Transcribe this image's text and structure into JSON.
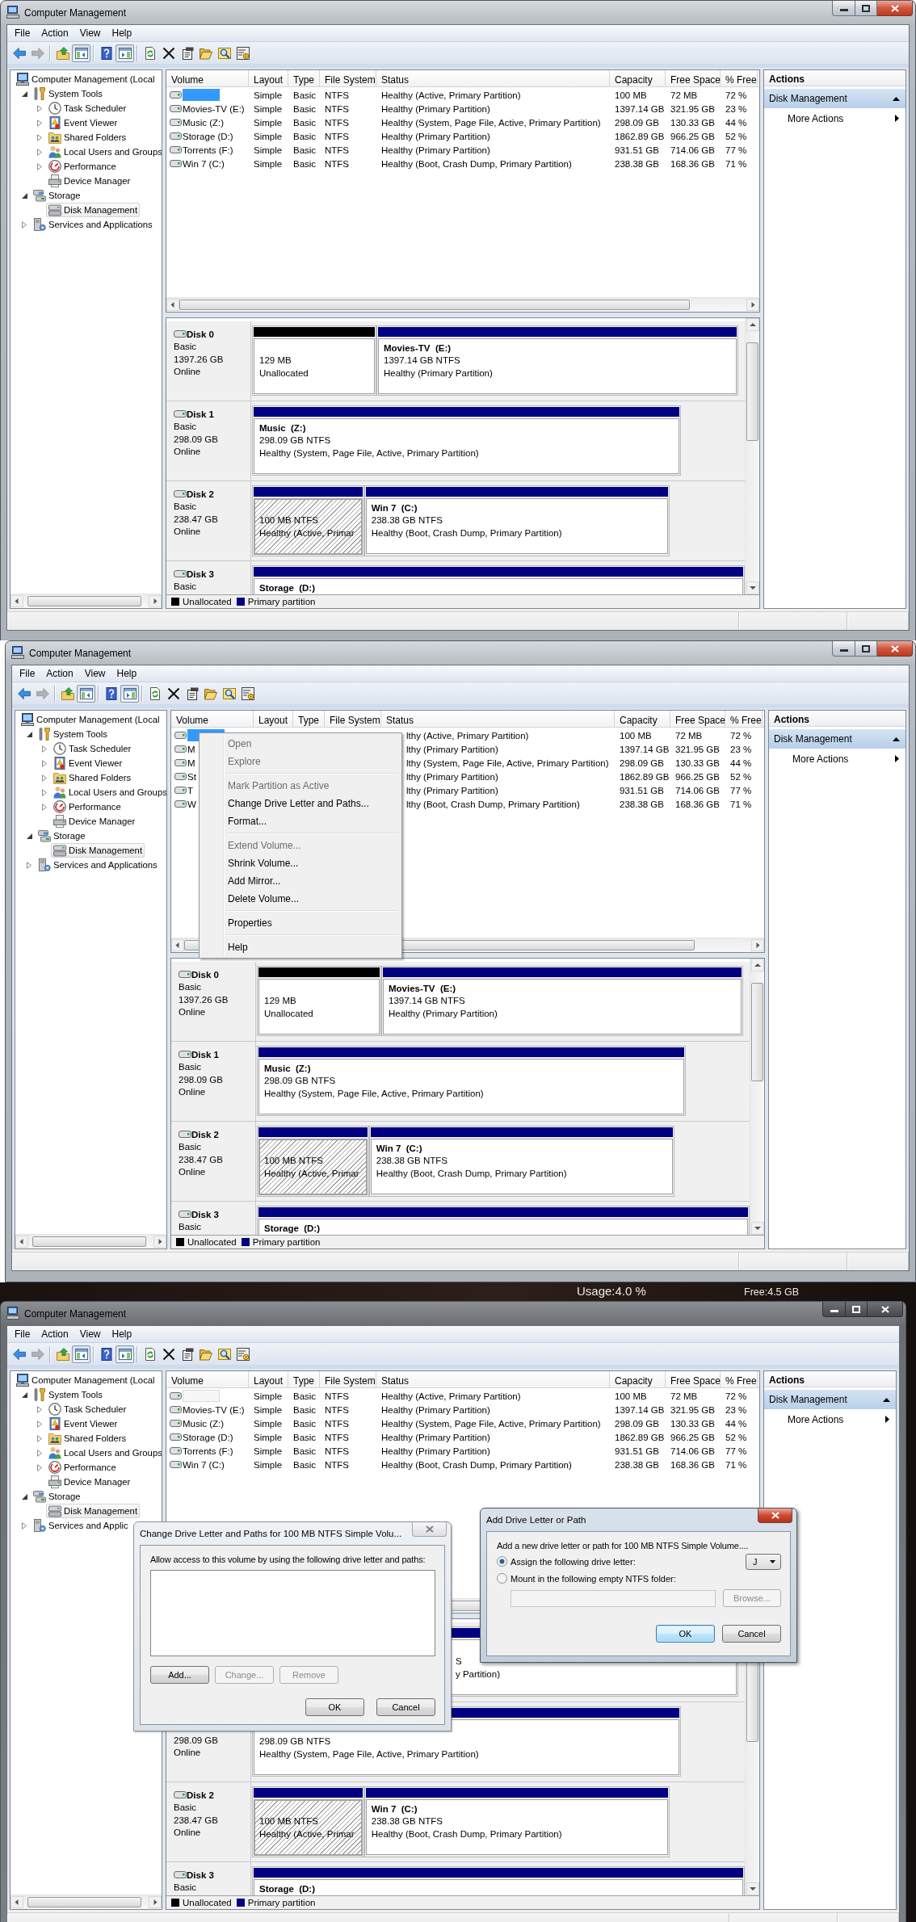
{
  "screenshots": [
    {
      "window": {
        "title": "Computer Management",
        "focused": true,
        "menu": [
          "File",
          "Action",
          "View",
          "Help"
        ],
        "toolbar": [
          [
            {
              "kind": "back",
              "disabled": false,
              "pressed": false
            },
            {
              "kind": "forward",
              "disabled": true,
              "pressed": false
            }
          ],
          [
            {
              "kind": "up",
              "disabled": false,
              "pressed": false
            },
            {
              "kind": "tree",
              "disabled": false,
              "pressed": true
            }
          ],
          [
            {
              "kind": "help",
              "disabled": false,
              "pressed": false
            },
            {
              "kind": "pane",
              "disabled": false,
              "pressed": true
            }
          ],
          [
            {
              "kind": "refresh",
              "disabled": false,
              "pressed": false
            },
            {
              "kind": "delete",
              "disabled": false,
              "pressed": false
            },
            {
              "kind": "properties",
              "disabled": false,
              "pressed": false
            },
            {
              "kind": "open",
              "disabled": false,
              "pressed": false
            },
            {
              "kind": "search",
              "disabled": false,
              "pressed": false
            },
            {
              "kind": "settings",
              "disabled": false,
              "pressed": false
            }
          ]
        ],
        "tree": [
          {
            "kind": "computer",
            "label": "Computer Management (Local",
            "selected": false,
            "children": [
              {
                "kind": "tools",
                "label": "System Tools",
                "expanded": true,
                "selected": false,
                "children": [
                  {
                    "kind": "scheduler",
                    "label": "Task Scheduler",
                    "expanded": false,
                    "selected": false
                  },
                  {
                    "kind": "events",
                    "label": "Event Viewer",
                    "expanded": false,
                    "selected": false
                  },
                  {
                    "kind": "shares",
                    "label": "Shared Folders",
                    "expanded": false,
                    "selected": false
                  },
                  {
                    "kind": "users",
                    "label": "Local Users and Groups",
                    "expanded": false,
                    "selected": false
                  },
                  {
                    "kind": "performance",
                    "label": "Performance",
                    "expanded": false,
                    "selected": false
                  },
                  {
                    "kind": "devices",
                    "label": "Device Manager",
                    "selected": false
                  }
                ]
              },
              {
                "kind": "storage",
                "label": "Storage",
                "expanded": true,
                "selected": false,
                "children": [
                  {
                    "kind": "disks",
                    "label": "Disk Management",
                    "selected": true
                  }
                ]
              },
              {
                "kind": "services",
                "label": "Services and Applications",
                "expanded": false,
                "selected": false
              }
            ]
          }
        ],
        "volumes": {
          "columns": [
            "Volume",
            "Layout",
            "Type",
            "File System",
            "Status",
            "Capacity",
            "Free Space",
            "% Free"
          ],
          "rows": [
            {
              "selected": true,
              "layout": "Simple",
              "type": "Basic",
              "file_system": "NTFS",
              "status": "Healthy (Active, Primary Partition)",
              "capacity": "100 MB",
              "free_space": "72 MB",
              "percent_free": "72 %"
            },
            {
              "selected": false,
              "volume": "Movies-TV (E:)",
              "layout": "Simple",
              "type": "Basic",
              "file_system": "NTFS",
              "status": "Healthy (Primary Partition)",
              "capacity": "1397.14 GB",
              "free_space": "321.95 GB",
              "percent_free": "23 %"
            },
            {
              "selected": false,
              "volume": "Music (Z:)",
              "layout": "Simple",
              "type": "Basic",
              "file_system": "NTFS",
              "status": "Healthy (System, Page File, Active, Primary Partition)",
              "capacity": "298.09 GB",
              "free_space": "130.33 GB",
              "percent_free": "44 %"
            },
            {
              "selected": false,
              "volume": "Storage (D:)",
              "layout": "Simple",
              "type": "Basic",
              "file_system": "NTFS",
              "status": "Healthy (Primary Partition)",
              "capacity": "1862.89 GB",
              "free_space": "966.25 GB",
              "percent_free": "52 %"
            },
            {
              "selected": false,
              "volume": "Torrents (F:)",
              "layout": "Simple",
              "type": "Basic",
              "file_system": "NTFS",
              "status": "Healthy (Primary Partition)",
              "capacity": "931.51 GB",
              "free_space": "714.06 GB",
              "percent_free": "77 %"
            },
            {
              "selected": false,
              "volume": "Win 7 (C:)",
              "layout": "Simple",
              "type": "Basic",
              "file_system": "NTFS",
              "status": "Healthy (Boot, Crash Dump, Primary Partition)",
              "capacity": "238.38 GB",
              "free_space": "168.36 GB",
              "percent_free": "71 %"
            }
          ]
        },
        "disks": [
          {
            "name": "Disk 0",
            "type": "Basic",
            "size": "1397.26 GB",
            "status": "Online",
            "partitions": [
              {
                "kind": "unallocated",
                "selected": false,
                "size": "129 MB",
                "status": "Unallocated"
              },
              {
                "kind": "primary",
                "selected": false,
                "name": "Movies-TV  (E:)",
                "size": "1397.14 GB NTFS",
                "status": "Healthy (Primary Partition)"
              }
            ]
          },
          {
            "name": "Disk 1",
            "type": "Basic",
            "size": "298.09 GB",
            "status": "Online",
            "partitions": [
              {
                "kind": "primary",
                "selected": false,
                "name": "Music  (Z:)",
                "size": "298.09 GB NTFS",
                "status": "Healthy (System, Page File, Active, Primary Partition)"
              }
            ]
          },
          {
            "name": "Disk 2",
            "type": "Basic",
            "size": "238.47 GB",
            "status": "Online",
            "partitions": [
              {
                "kind": "primary",
                "selected": true,
                "size": "100 MB NTFS",
                "status": "Healthy (Active, Primar"
              },
              {
                "kind": "primary",
                "selected": false,
                "name": "Win 7  (C:)",
                "size": "238.38 GB NTFS",
                "status": "Healthy (Boot, Crash Dump, Primary Partition)"
              }
            ]
          },
          {
            "name": "Disk 3",
            "type": "Basic",
            "partitions": [
              {
                "kind": "primary",
                "selected": false,
                "name": "Storage  (D:)"
              }
            ]
          }
        ],
        "legend": [
          {
            "kind": "unallocated",
            "label": "Unallocated"
          },
          {
            "kind": "primary",
            "label": "Primary partition"
          }
        ],
        "actions": {
          "title": "Actions",
          "sections": [
            {
              "label": "Disk Management",
              "expanded": true,
              "items": [
                "More Actions"
              ]
            }
          ]
        }
      }
    },
    {
      "window": {
        "title": "Computer Management",
        "focused": true,
        "menu": [
          "File",
          "Action",
          "View",
          "Help"
        ],
        "toolbar": [
          [
            {
              "kind": "back",
              "disabled": false,
              "pressed": false
            },
            {
              "kind": "forward",
              "disabled": true,
              "pressed": false
            }
          ],
          [
            {
              "kind": "up",
              "disabled": false,
              "pressed": false
            },
            {
              "kind": "tree",
              "disabled": false,
              "pressed": true
            }
          ],
          [
            {
              "kind": "help",
              "disabled": false,
              "pressed": false
            },
            {
              "kind": "pane",
              "disabled": false,
              "pressed": true
            }
          ],
          [
            {
              "kind": "refresh",
              "disabled": false,
              "pressed": false
            },
            {
              "kind": "delete",
              "disabled": false,
              "pressed": false
            },
            {
              "kind": "properties",
              "disabled": false,
              "pressed": false
            },
            {
              "kind": "open",
              "disabled": false,
              "pressed": false
            },
            {
              "kind": "search",
              "disabled": false,
              "pressed": false
            },
            {
              "kind": "settings",
              "disabled": false,
              "pressed": false
            }
          ]
        ],
        "tree": [
          {
            "kind": "computer",
            "label": "Computer Management (Local",
            "selected": false,
            "children": [
              {
                "kind": "tools",
                "label": "System Tools",
                "expanded": true,
                "selected": false,
                "children": [
                  {
                    "kind": "scheduler",
                    "label": "Task Scheduler",
                    "expanded": false,
                    "selected": false
                  },
                  {
                    "kind": "events",
                    "label": "Event Viewer",
                    "expanded": false,
                    "selected": false
                  },
                  {
                    "kind": "shares",
                    "label": "Shared Folders",
                    "expanded": false,
                    "selected": false
                  },
                  {
                    "kind": "users",
                    "label": "Local Users and Groups",
                    "expanded": false,
                    "selected": false
                  },
                  {
                    "kind": "performance",
                    "label": "Performance",
                    "expanded": false,
                    "selected": false
                  },
                  {
                    "kind": "devices",
                    "label": "Device Manager",
                    "selected": false
                  }
                ]
              },
              {
                "kind": "storage",
                "label": "Storage",
                "expanded": true,
                "selected": false,
                "children": [
                  {
                    "kind": "disks",
                    "label": "Disk Management",
                    "selected": true
                  }
                ]
              },
              {
                "kind": "services",
                "label": "Services and Applications",
                "expanded": false,
                "selected": false
              }
            ]
          }
        ],
        "volumes": {
          "columns": [
            "Volume",
            "Layout",
            "Type",
            "File System",
            "Status",
            "Capacity",
            "Free Space",
            "% Free"
          ],
          "rows": [
            {
              "selected": true,
              "status": "lthy (Active, Primary Partition)",
              "capacity": "100 MB",
              "free_space": "72 MB",
              "percent_free": "72 %"
            },
            {
              "selected": false,
              "volume": "M",
              "status": "lthy (Primary Partition)",
              "capacity": "1397.14 GB",
              "free_space": "321.95 GB",
              "percent_free": "23 %"
            },
            {
              "selected": false,
              "volume": "M",
              "status": "lthy (System, Page File, Active, Primary Partition)",
              "capacity": "298.09 GB",
              "free_space": "130.33 GB",
              "percent_free": "44 %"
            },
            {
              "selected": false,
              "volume": "St",
              "status": "lthy (Primary Partition)",
              "capacity": "1862.89 GB",
              "free_space": "966.25 GB",
              "percent_free": "52 %"
            },
            {
              "selected": false,
              "volume": "T",
              "status": "lthy (Primary Partition)",
              "capacity": "931.51 GB",
              "free_space": "714.06 GB",
              "percent_free": "77 %"
            },
            {
              "selected": false,
              "volume": "W",
              "status": "lthy (Boot, Crash Dump, Primary Partition)",
              "capacity": "238.38 GB",
              "free_space": "168.36 GB",
              "percent_free": "71 %"
            }
          ]
        },
        "context_menu": {
          "groups": [
            [
              {
                "label": "Open",
                "disabled": true
              },
              {
                "label": "Explore",
                "disabled": true
              }
            ],
            [
              {
                "label": "Mark Partition as Active",
                "disabled": true
              },
              {
                "label": "Change Drive Letter and Paths...",
                "disabled": false
              },
              {
                "label": "Format...",
                "disabled": false
              }
            ],
            [
              {
                "label": "Extend Volume...",
                "disabled": true
              },
              {
                "label": "Shrink Volume...",
                "disabled": false
              },
              {
                "label": "Add Mirror...",
                "disabled": false
              },
              {
                "label": "Delete Volume...",
                "disabled": false
              }
            ],
            [
              {
                "label": "Properties",
                "disabled": false
              }
            ],
            [
              {
                "label": "Help",
                "disabled": false
              }
            ]
          ]
        },
        "disks": [
          {
            "name": "Disk 0",
            "type": "Basic",
            "size": "1397.26 GB",
            "status": "Online",
            "partitions": [
              {
                "kind": "unallocated",
                "selected": false,
                "size": "129 MB",
                "status": "Unallocated"
              },
              {
                "kind": "primary",
                "selected": false,
                "name": "Movies-TV  (E:)",
                "size": "1397.14 GB NTFS",
                "status": "Healthy (Primary Partition)"
              }
            ]
          },
          {
            "name": "Disk 1",
            "type": "Basic",
            "size": "298.09 GB",
            "status": "Online",
            "partitions": [
              {
                "kind": "primary",
                "selected": false,
                "name": "Music  (Z:)",
                "size": "298.09 GB NTFS",
                "status": "Healthy (System, Page File, Active, Primary Partition)"
              }
            ]
          },
          {
            "name": "Disk 2",
            "type": "Basic",
            "size": "238.47 GB",
            "status": "Online",
            "partitions": [
              {
                "kind": "primary",
                "selected": true,
                "size": "100 MB NTFS",
                "status": "Healthy (Active, Primar"
              },
              {
                "kind": "primary",
                "selected": false,
                "name": "Win 7  (C:)",
                "size": "238.38 GB NTFS",
                "status": "Healthy (Boot, Crash Dump, Primary Partition)"
              }
            ]
          },
          {
            "name": "Disk 3",
            "type": "Basic",
            "partitions": [
              {
                "kind": "primary",
                "selected": false,
                "name": "Storage  (D:)"
              }
            ]
          }
        ],
        "legend": [
          {
            "kind": "unallocated",
            "label": "Unallocated"
          },
          {
            "kind": "primary",
            "label": "Primary partition"
          }
        ],
        "actions": {
          "title": "Actions",
          "sections": [
            {
              "label": "Disk Management",
              "expanded": true,
              "items": [
                "More Actions"
              ]
            }
          ]
        }
      }
    },
    {
      "desktop_gadgets": [
        "Usage:4.0 %",
        "Free:4.5 GB"
      ],
      "window": {
        "title": "Computer Management",
        "focused": false,
        "menu": [
          "File",
          "Action",
          "View",
          "Help"
        ],
        "toolbar": [
          [
            {
              "kind": "back",
              "disabled": false,
              "pressed": false
            },
            {
              "kind": "forward",
              "disabled": true,
              "pressed": false
            }
          ],
          [
            {
              "kind": "up",
              "disabled": false,
              "pressed": false
            },
            {
              "kind": "tree",
              "disabled": false,
              "pressed": true
            }
          ],
          [
            {
              "kind": "help",
              "disabled": false,
              "pressed": false
            },
            {
              "kind": "pane",
              "disabled": false,
              "pressed": true
            }
          ],
          [
            {
              "kind": "refresh",
              "disabled": false,
              "pressed": false
            },
            {
              "kind": "delete",
              "disabled": false,
              "pressed": false
            },
            {
              "kind": "properties",
              "disabled": false,
              "pressed": false
            },
            {
              "kind": "open",
              "disabled": false,
              "pressed": false
            },
            {
              "kind": "search",
              "disabled": false,
              "pressed": false
            },
            {
              "kind": "settings",
              "disabled": false,
              "pressed": false
            }
          ]
        ],
        "tree": [
          {
            "kind": "computer",
            "label": "Computer Management (Local",
            "selected": false,
            "children": [
              {
                "kind": "tools",
                "label": "System Tools",
                "expanded": true,
                "selected": false,
                "children": [
                  {
                    "kind": "scheduler",
                    "label": "Task Scheduler",
                    "expanded": false,
                    "selected": false
                  },
                  {
                    "kind": "events",
                    "label": "Event Viewer",
                    "expanded": false,
                    "selected": false
                  },
                  {
                    "kind": "shares",
                    "label": "Shared Folders",
                    "expanded": false,
                    "selected": false
                  },
                  {
                    "kind": "users",
                    "label": "Local Users and Groups",
                    "expanded": false,
                    "selected": false
                  },
                  {
                    "kind": "performance",
                    "label": "Performance",
                    "expanded": false,
                    "selected": false
                  },
                  {
                    "kind": "devices",
                    "label": "Device Manager",
                    "selected": false
                  }
                ]
              },
              {
                "kind": "storage",
                "label": "Storage",
                "expanded": true,
                "selected": false,
                "children": [
                  {
                    "kind": "disks",
                    "label": "Disk Management",
                    "selected": true
                  }
                ]
              },
              {
                "kind": "services",
                "label": "Services and Applic",
                "expanded": false,
                "selected": false
              }
            ]
          }
        ],
        "volumes": {
          "columns": [
            "Volume",
            "Layout",
            "Type",
            "File System",
            "Status",
            "Capacity",
            "Free Space",
            "% Free"
          ],
          "rows": [
            {
              "selected": true,
              "layout": "Simple",
              "type": "Basic",
              "file_system": "NTFS",
              "status": "Healthy (Active, Primary Partition)",
              "capacity": "100 MB",
              "free_space": "72 MB",
              "percent_free": "72 %"
            },
            {
              "selected": false,
              "volume": "Movies-TV (E:)",
              "layout": "Simple",
              "type": "Basic",
              "file_system": "NTFS",
              "status": "Healthy (Primary Partition)",
              "capacity": "1397.14 GB",
              "free_space": "321.95 GB",
              "percent_free": "23 %"
            },
            {
              "selected": false,
              "volume": "Music (Z:)",
              "layout": "Simple",
              "type": "Basic",
              "file_system": "NTFS",
              "status": "Healthy (System, Page File, Active, Primary Partition)",
              "capacity": "298.09 GB",
              "free_space": "130.33 GB",
              "percent_free": "44 %"
            },
            {
              "selected": false,
              "volume": "Storage (D:)",
              "layout": "Simple",
              "type": "Basic",
              "file_system": "NTFS",
              "status": "Healthy (Primary Partition)",
              "capacity": "1862.89 GB",
              "free_space": "966.25 GB",
              "percent_free": "52 %"
            },
            {
              "selected": false,
              "volume": "Torrents (F:)",
              "layout": "Simple",
              "type": "Basic",
              "file_system": "NTFS",
              "status": "Healthy (Primary Partition)",
              "capacity": "931.51 GB",
              "free_space": "714.06 GB",
              "percent_free": "77 %"
            },
            {
              "selected": false,
              "volume": "Win 7 (C:)",
              "layout": "Simple",
              "type": "Basic",
              "file_system": "NTFS",
              "status": "Healthy (Boot, Crash Dump, Primary Partition)",
              "capacity": "238.38 GB",
              "free_space": "168.36 GB",
              "percent_free": "71 %"
            }
          ]
        },
        "disks": [
          {
            "partitions": [
              {
                "kind": "primary",
                "selected": false,
                "size": "S",
                "status": "y Partition)"
              }
            ]
          },
          {
            "size": "298.09 GB",
            "status": "Online",
            "partitions": [
              {
                "kind": "primary",
                "selected": false,
                "size": "298.09 GB NTFS",
                "status": "Healthy (System, Page File, Active, Primary Partition)"
              }
            ]
          },
          {
            "name": "Disk 2",
            "type": "Basic",
            "size": "238.47 GB",
            "status": "Online",
            "partitions": [
              {
                "kind": "primary",
                "selected": true,
                "size": "100 MB NTFS",
                "status": "Healthy (Active, Primar"
              },
              {
                "kind": "primary",
                "selected": false,
                "name": "Win 7  (C:)",
                "size": "238.38 GB NTFS",
                "status": "Healthy (Boot, Crash Dump, Primary Partition)"
              }
            ]
          },
          {
            "name": "Disk 3",
            "type": "Basic",
            "partitions": [
              {
                "kind": "primary",
                "selected": false,
                "name": "Storage  (D:)"
              }
            ]
          }
        ],
        "legend": [
          {
            "kind": "unallocated",
            "label": "Unallocated"
          },
          {
            "kind": "primary",
            "label": "Primary partition"
          }
        ],
        "actions": {
          "title": "Actions",
          "sections": [
            {
              "label": "Disk Management",
              "expanded": true,
              "items": [
                "More Actions"
              ]
            }
          ]
        },
        "dialogs": [
          {
            "kind": "paths",
            "focused": false,
            "title": "Change Drive Letter and Paths for 100 MB NTFS Simple Volu...",
            "prompt": "Allow access to this volume by using the following drive letter and paths:",
            "row_buttons": [
              {
                "label": "Add...",
                "disabled": false
              },
              {
                "label": "Change...",
                "disabled": true
              },
              {
                "label": "Remove",
                "disabled": true
              }
            ],
            "buttons": [
              {
                "label": "OK",
                "default": false
              },
              {
                "label": "Cancel",
                "default": false
              }
            ]
          },
          {
            "kind": "assign",
            "focused": true,
            "title": "Add Drive Letter or Path",
            "prompt": "Add a new drive letter or path for 100 MB NTFS Simple Volume....",
            "options": [
              {
                "kind": "letter",
                "label": "Assign the following drive letter:",
                "selected": true,
                "value": "J"
              },
              {
                "kind": "folder",
                "label": "Mount in the following empty NTFS folder:",
                "selected": false,
                "field_disabled": true,
                "browse": {
                  "label": "Browse...",
                  "disabled": true
                }
              }
            ],
            "buttons": [
              {
                "label": "OK",
                "default": true
              },
              {
                "label": "Cancel",
                "default": false
              }
            ]
          }
        ]
      }
    }
  ]
}
